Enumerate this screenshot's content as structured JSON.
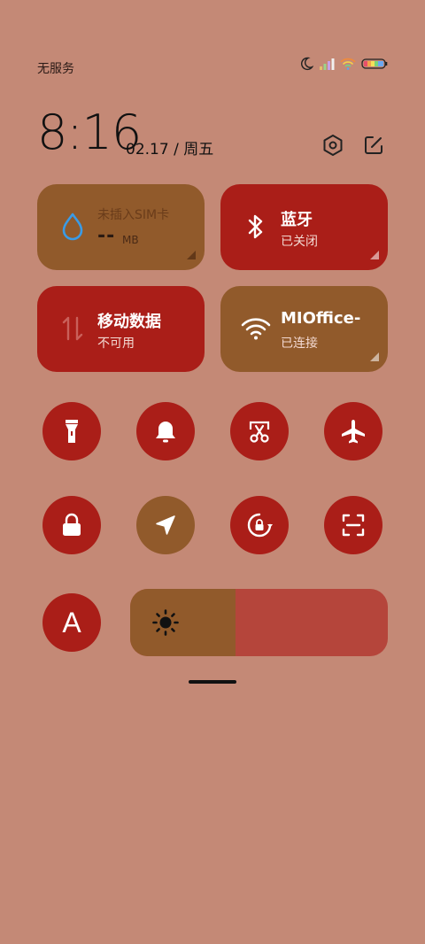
{
  "status_bar": {
    "carrier": "无服务"
  },
  "header": {
    "time": "8:16",
    "date": "02.17 / 周五"
  },
  "tiles": {
    "data_usage": {
      "title": "未插入SIM卡",
      "value": "--",
      "unit": "MB"
    },
    "bluetooth": {
      "title": "蓝牙",
      "status": "已关闭"
    },
    "mobile_data": {
      "title": "移动数据",
      "status": "不可用"
    },
    "wifi": {
      "title": "MIOffice-",
      "status": "已连接"
    }
  },
  "toggles": [
    {
      "name": "flashlight-icon"
    },
    {
      "name": "bell-icon"
    },
    {
      "name": "screenshot-icon"
    },
    {
      "name": "airplane-icon"
    },
    {
      "name": "lock-icon"
    },
    {
      "name": "location-icon"
    },
    {
      "name": "rotation-lock-icon"
    },
    {
      "name": "scanner-icon"
    }
  ],
  "auto_brightness_label": "A",
  "brightness": {
    "level": 0.41
  },
  "colors": {
    "background": "#c48976",
    "red": "#aa1e18",
    "brown": "#915a2b",
    "slider_track": "#b5453b"
  }
}
